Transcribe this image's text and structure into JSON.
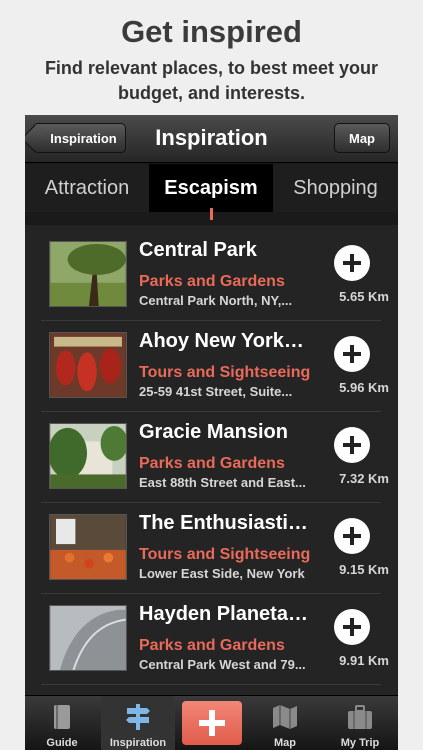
{
  "promo": {
    "title": "Get inspired",
    "subtitle": "Find relevant places, to best meet your budget, and interests."
  },
  "navbar": {
    "back_label": "Inspiration",
    "title": "Inspiration",
    "map_label": "Map"
  },
  "tabs": [
    {
      "label": "Attraction",
      "active": false
    },
    {
      "label": "Escapism",
      "active": true
    },
    {
      "label": "Shopping",
      "active": false
    }
  ],
  "places": [
    {
      "name": "Central Park",
      "category": "Parks and Gardens",
      "address": "Central Park North, NY,...",
      "distance": "5.65 Km",
      "thumb": "park-tree-icon"
    },
    {
      "name": "Ahoy New York…",
      "category": "Tours and Sightseeing",
      "address": "25-59 41st Street, Suite...",
      "distance": "5.96 Km",
      "thumb": "lanterns-icon"
    },
    {
      "name": "Gracie Mansion",
      "category": "Parks and Gardens",
      "address": "East 88th Street and East...",
      "distance": "7.32 Km",
      "thumb": "mansion-icon"
    },
    {
      "name": "The Enthusiastic…",
      "category": "Tours and Sightseeing",
      "address": "Lower East Side, New York",
      "distance": "9.15 Km",
      "thumb": "market-icon"
    },
    {
      "name": "Hayden Planetarium",
      "category": "Parks and Gardens",
      "address": "Central Park West and 79...",
      "distance": "9.91 Km",
      "thumb": "planetarium-icon"
    }
  ],
  "tabbar": {
    "items": [
      {
        "label": "Guide",
        "icon": "book-icon"
      },
      {
        "label": "Inspiration",
        "icon": "signpost-icon",
        "active": true
      },
      {
        "label": "",
        "icon": "plus-icon"
      },
      {
        "label": "Map",
        "icon": "map-icon"
      },
      {
        "label": "My Trip",
        "icon": "suitcase-icon"
      }
    ]
  },
  "colors": {
    "accent": "#ea6a5a",
    "background": "#242424"
  }
}
